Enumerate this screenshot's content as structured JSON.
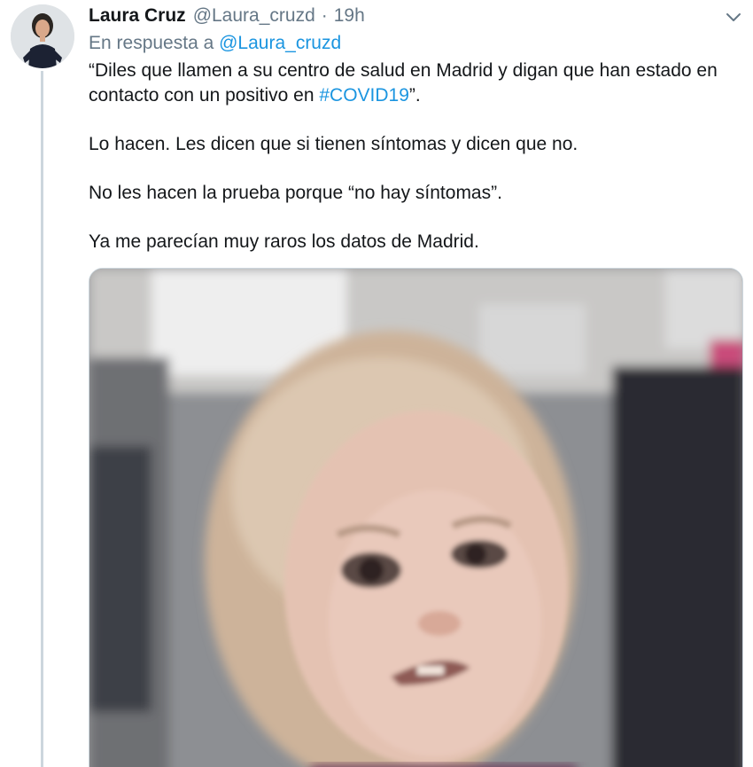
{
  "tweet": {
    "author_name": "Laura Cruz",
    "author_handle": "@Laura_cruzd",
    "separator": "·",
    "time": "19h",
    "reply_prefix": "En respuesta a",
    "reply_handle": "@Laura_cruzd",
    "line1_before": "“Diles que llamen a su centro de salud en Madrid y digan que han estado en contacto con un positivo en ",
    "hashtag": "#COVID19",
    "line1_after": "”.",
    "para2": "Lo hacen. Les dicen que si tienen síntomas y dicen que no.",
    "para3": "No les hacen la prueba porque “no hay síntomas”.",
    "para4": "Ya me parecían muy raros los datos de Madrid."
  },
  "icons": {
    "avatar": "avatar-photo",
    "caret": "chevron-down-icon",
    "media": "gif-image"
  },
  "colors": {
    "link": "#1b95e0",
    "secondary_text": "#657786",
    "primary_text": "#14171a",
    "thread_line": "#ccd6dd"
  }
}
